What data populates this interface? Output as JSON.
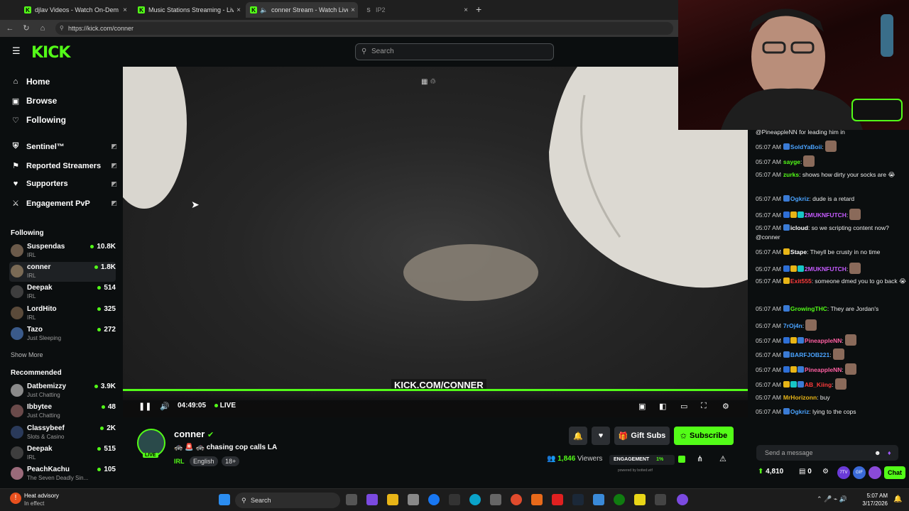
{
  "browser": {
    "tabs": [
      {
        "title": "djlav Videos - Watch On-Dem",
        "icon": "kick-icon",
        "color": "#53fc18"
      },
      {
        "title": "Music Stations Streaming - Live St",
        "icon": "kick-icon",
        "color": "#53fc18"
      },
      {
        "title": "conner Stream - Watch Live o",
        "icon": "kick-icon",
        "color": "#53fc18",
        "active": true
      },
      {
        "title": "IP2",
        "icon": "s-icon",
        "color": "#888888"
      }
    ],
    "url": "https://kick.com/conner",
    "new_tab": "+"
  },
  "header": {
    "logo": "KICK",
    "search_placeholder": "Search"
  },
  "sidebar": {
    "nav": [
      {
        "label": "Home",
        "icon": "home-icon"
      },
      {
        "label": "Browse",
        "icon": "browse-icon"
      },
      {
        "label": "Following",
        "icon": "heart-icon"
      }
    ],
    "mod_nav": [
      {
        "label": "Sentinel™",
        "icon": "shield-icon"
      },
      {
        "label": "Reported Streamers",
        "icon": "flag-icon"
      },
      {
        "label": "Supporters",
        "icon": "heart-icon"
      },
      {
        "label": "Engagement PvP",
        "icon": "swords-icon"
      }
    ],
    "following_title": "Following",
    "following": [
      {
        "name": "Suspendas",
        "category": "IRL",
        "viewers": "10.8K"
      },
      {
        "name": "conner",
        "category": "IRL",
        "viewers": "1.8K",
        "selected": true
      },
      {
        "name": "Deepak",
        "category": "IRL",
        "viewers": "514"
      },
      {
        "name": "LordHito",
        "category": "IRL",
        "viewers": "325"
      },
      {
        "name": "Tazo",
        "category": "Just Sleeping",
        "viewers": "272"
      }
    ],
    "show_more": "Show More",
    "recommended_title": "Recommended",
    "recommended": [
      {
        "name": "Datbemizzy",
        "category": "Just Chatting",
        "viewers": "3.9K"
      },
      {
        "name": "Ibbytee",
        "category": "Just Chatting",
        "viewers": "48"
      },
      {
        "name": "Classybeef",
        "category": "Slots & Casino",
        "viewers": "2K"
      },
      {
        "name": "Deepak",
        "category": "IRL",
        "viewers": "515"
      },
      {
        "name": "PeachKachu",
        "category": "The Seven Deadly Sin...",
        "viewers": "105"
      }
    ]
  },
  "player": {
    "watermark": "KICK.COM/CONNER",
    "elapsed": "04:49:05",
    "live_label": "LIVE",
    "progress": 1.0
  },
  "stream": {
    "streamer": "conner",
    "live_badge": "LIVE",
    "title": "chasing cop calls LA",
    "category": "IRL",
    "tags": [
      "English",
      "18+"
    ],
    "viewers": "1,846",
    "viewers_label": "Viewers",
    "engagement_label": "ENGAGEMENT",
    "engagement_value": "1%",
    "powered_by": "powered by botted.wtf",
    "gift_subs": "Gift Subs",
    "subscribe": "Subscribe"
  },
  "chat": {
    "first_line": "@PineappleNN for leading him in",
    "messages": [
      {
        "time": "05:07 AM",
        "user": "SoldYaBoii",
        "color": "#4aa3ff",
        "text": ":",
        "badges": [
          "#3a7bd5"
        ],
        "emote": true
      },
      {
        "time": "05:07 AM",
        "user": "sayge",
        "color": "#53fc18",
        "text": ":",
        "badges": [],
        "emote": true
      },
      {
        "time": "05:07 AM",
        "user": "zurks",
        "color": "#53fc18",
        "text": ": shows how dirty your socks are 😭",
        "badges": []
      },
      {
        "time": "05:07 AM",
        "user": "Ogkriz",
        "color": "#4aa3ff",
        "text": ": dude is a retard",
        "badges": [
          "#3a7bd5"
        ]
      },
      {
        "time": "05:07 AM",
        "user": "2MUKNFUTCH",
        "color": "#c65bff",
        "text": ":",
        "badges": [
          "#2e6fd6",
          "#e8b517",
          "#18c5c5"
        ],
        "emote": true
      },
      {
        "time": "05:07 AM",
        "user": "icloud",
        "color": "#ffffff",
        "text": ": so we scripting content now? @conner",
        "badges": [
          "#3a7bd5"
        ]
      },
      {
        "time": "05:07 AM",
        "user": "Stape",
        "color": "#ffffff",
        "text": ": Theyll be crusty in no time",
        "badges": [
          "#e8b517"
        ]
      },
      {
        "time": "05:07 AM",
        "user": "2MUKNFUTCH",
        "color": "#c65bff",
        "text": ":",
        "badges": [
          "#2e6fd6",
          "#e8b517",
          "#18c5c5"
        ],
        "emote": true
      },
      {
        "time": "05:07 AM",
        "user": "Exit555",
        "color": "#ff3b3b",
        "text": ": someone dmed you to go back 😭",
        "badges": [
          "#e8b517"
        ]
      },
      {
        "time": "05:07 AM",
        "user": "GrowingTHC",
        "color": "#53fc18",
        "text": ": They are Jordan's",
        "badges": [
          "#3a7bd5"
        ]
      },
      {
        "time": "05:07 AM",
        "user": "7rOj4n",
        "color": "#4aa3ff",
        "text": ":",
        "badges": [],
        "emote": true
      },
      {
        "time": "05:07 AM",
        "user": "PineappleNN",
        "color": "#ff5fa2",
        "text": ":",
        "badges": [
          "#2e6fd6",
          "#e8b517",
          "#3a7bd5"
        ],
        "emote": true
      },
      {
        "time": "05:07 AM",
        "user": "BARFJOB221",
        "color": "#4aa3ff",
        "text": ":",
        "badges": [
          "#3a7bd5"
        ],
        "emote": true
      },
      {
        "time": "05:07 AM",
        "user": "PineappleNN",
        "color": "#ff5fa2",
        "text": ":",
        "badges": [
          "#2e6fd6",
          "#e8b517",
          "#3a7bd5"
        ],
        "emote": true
      },
      {
        "time": "05:07 AM",
        "user": "AB_Kiing",
        "color": "#ff3b3b",
        "text": ":",
        "badges": [
          "#e8b517",
          "#18c5c5",
          "#3a7bd5"
        ],
        "emote": true
      },
      {
        "time": "05:07 AM",
        "user": "MrHorizonn",
        "color": "#e8b517",
        "text": ": buy",
        "badges": []
      },
      {
        "time": "05:07 AM",
        "user": "Ogkriz",
        "color": "#4aa3ff",
        "text": ": lying to the cops",
        "badges": [
          "#3a7bd5"
        ]
      }
    ],
    "input_placeholder": "Send a message",
    "points": "4,810",
    "gifts": "0",
    "chat_button": "Chat"
  },
  "taskbar": {
    "weather_title": "Heat advisory",
    "weather_sub": "In effect",
    "search": "Search",
    "time": "5:07 AM",
    "date": "3/17/2026"
  }
}
